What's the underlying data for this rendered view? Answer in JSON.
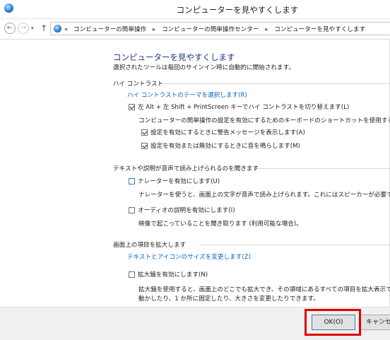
{
  "window": {
    "title": "コンピューターを見やすくします"
  },
  "nav": {
    "back_glyph": "←",
    "forward_glyph": "→",
    "dropdown_glyph": "▾",
    "up_glyph": "↑",
    "breadcrumb_prefix": "«",
    "breadcrumbs": [
      "コンピューターの簡単操作",
      "コンピューターの簡単操作センター",
      "コンピューターを見やすくします"
    ],
    "separator": "▸"
  },
  "page": {
    "heading": "コンピューターを見やすくします",
    "subheading": "選択されたツールは毎回のサインイン時に自動的に開始されます。"
  },
  "high_contrast": {
    "section_label": "ハイ コントラスト",
    "theme_link": "ハイ コントラストのテーマを選択します(R)",
    "toggle_label": "左 Alt + 左 Shift + PrintScreen キーでハイ コントラストを切り替えます(L)",
    "toggle_checked": true,
    "shortcut_desc": "コンピューターの簡単操作の設定を有効にするためのキーボードのショートカットを使用する場合:",
    "warn_label": "設定を有効にするときに警告メッセージを表示します(A)",
    "warn_checked": true,
    "sound_label": "設定を有効または無効にするときに音を鳴らします(M)",
    "sound_checked": true
  },
  "narration": {
    "section_label": "テキストや説明が音声で読み上げられるのを聞きます",
    "narrator_label": "ナレーターを有効にします(U)",
    "narrator_checked": false,
    "narrator_desc": "ナレーターを使うと、画面上の文字が音声で読み上げられます。これにはスピーカーが必要です。",
    "audio_label": "オーディオの説明を有効にします(I)",
    "audio_checked": false,
    "audio_desc": "映像で起こっていることを聞き取ります (利用可能な場合)。"
  },
  "magnify": {
    "section_label": "画面上の項目を拡大します",
    "size_link": "テキストとアイコンのサイズを変更します(Z)",
    "magnifier_label": "拡大鏡を有効にします(N)",
    "magnifier_checked": false,
    "magnifier_desc_1": "拡大鏡を使用すると、画面上のどこでも拡大でき、その領域にあるすべての項目を拡大表示でき",
    "magnifier_desc_2": "動かしたり、1 か所に固定したり、大きさを変更したりできます。"
  },
  "footer": {
    "ok_label": "OK(O)",
    "cancel_label": "キャンセル"
  },
  "colors": {
    "heading": "#1e3287",
    "link": "#0a66c2",
    "highlight": "#e00000"
  }
}
